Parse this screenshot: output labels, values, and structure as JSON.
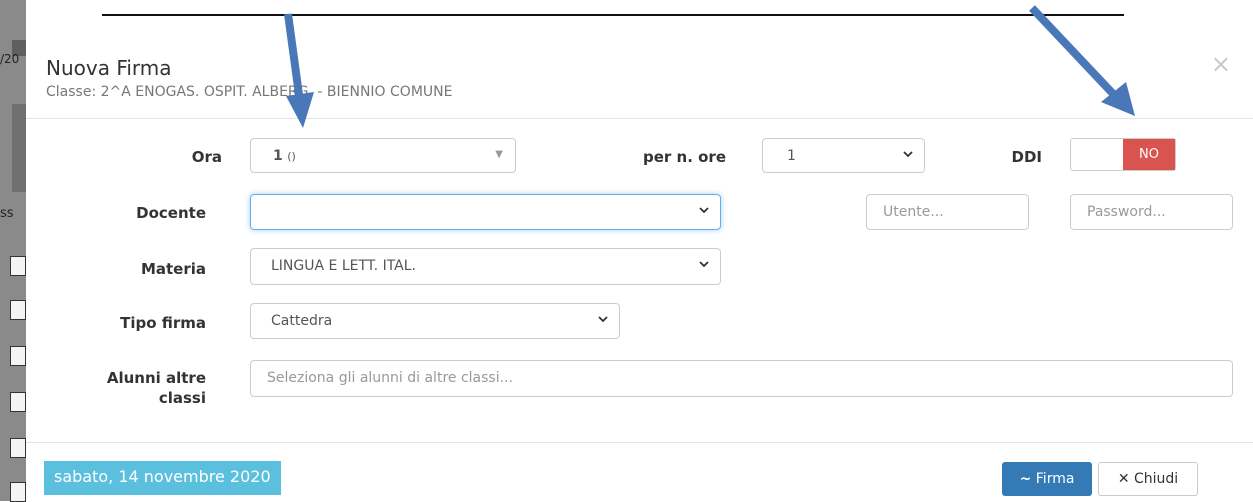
{
  "background": {
    "fragments": [
      "/20",
      "ss"
    ]
  },
  "modal": {
    "title": "Nuova Firma",
    "subtitle": "Classe: 2^A ENOGAS. OSPIT. ALBERG. - BIENNIO COMUNE",
    "close_icon": "×"
  },
  "form": {
    "ora": {
      "label": "Ora",
      "value_num": "1",
      "value_extra": "()"
    },
    "per_n_ore": {
      "label": "per n. ore",
      "value": "1"
    },
    "ddi": {
      "label": "DDI",
      "value": "NO"
    },
    "docente": {
      "label": "Docente",
      "value": ""
    },
    "utente": {
      "placeholder": "Utente..."
    },
    "password": {
      "placeholder": "Password..."
    },
    "materia": {
      "label": "Materia",
      "value": "LINGUA E LETT. ITAL."
    },
    "tipo_firma": {
      "label": "Tipo firma",
      "value": "Cattedra"
    },
    "alunni": {
      "label_line1": "Alunni altre",
      "label_line2": "classi",
      "placeholder": "Seleziona gli alunni di altre classi..."
    }
  },
  "footer": {
    "date": "sabato, 14 novembre 2020",
    "firma_label": "Firma",
    "chiudi_label": "Chiudi"
  },
  "colors": {
    "primary": "#337ab7",
    "danger": "#d9534f",
    "info": "#5bc0de",
    "arrow": "#4a77b8"
  }
}
